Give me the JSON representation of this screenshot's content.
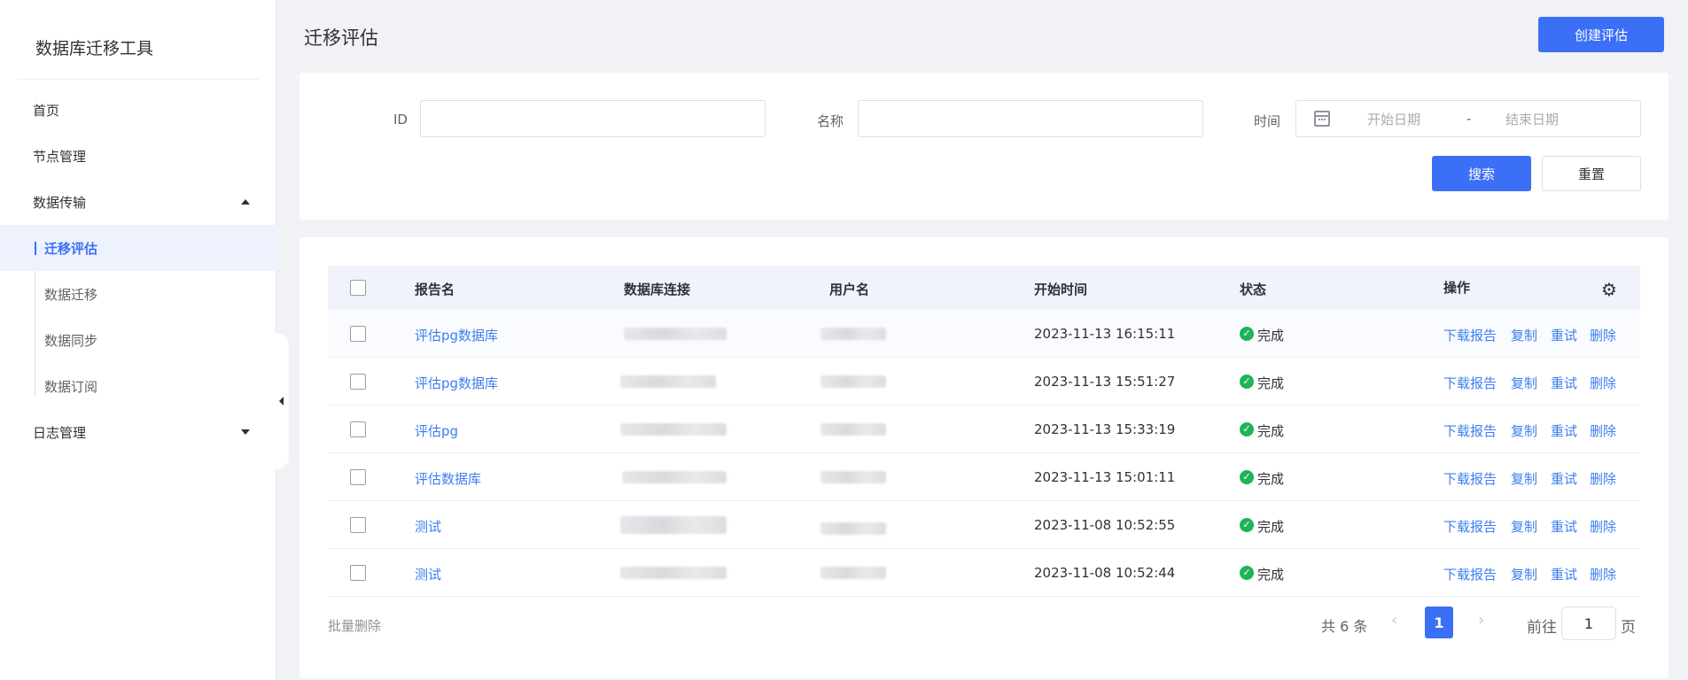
{
  "app": {
    "title": "数据库迁移工具"
  },
  "sidebar": {
    "items": [
      {
        "label": "首页"
      },
      {
        "label": "节点管理"
      },
      {
        "label": "数据传输"
      },
      {
        "label": "迁移评估"
      },
      {
        "label": "数据迁移"
      },
      {
        "label": "数据同步"
      },
      {
        "label": "数据订阅"
      },
      {
        "label": "日志管理"
      }
    ]
  },
  "header": {
    "title": "迁移评估",
    "create_label": "创建评估"
  },
  "filter": {
    "id_label": "ID",
    "name_label": "名称",
    "time_label": "时间",
    "id_value": "",
    "name_value": "",
    "date_start_placeholder": "开始日期",
    "date_separator": "-",
    "date_end_placeholder": "结束日期",
    "search_label": "搜索",
    "reset_label": "重置"
  },
  "table": {
    "columns": [
      "报告名",
      "数据库连接",
      "用户名",
      "开始时间",
      "状态",
      "操作"
    ],
    "rows": [
      {
        "name": "评估pg数据库",
        "time": "2023-11-13 16:15:11",
        "status": "完成"
      },
      {
        "name": "评估pg数据库",
        "time": "2023-11-13 15:51:27",
        "status": "完成"
      },
      {
        "name": "评估pg",
        "time": "2023-11-13 15:33:19",
        "status": "完成"
      },
      {
        "name": "评估数据库",
        "time": "2023-11-13 15:01:11",
        "status": "完成"
      },
      {
        "name": "测试",
        "time": "2023-11-08 10:52:55",
        "status": "完成"
      },
      {
        "name": "测试",
        "time": "2023-11-08 10:52:44",
        "status": "完成"
      }
    ],
    "actions": {
      "download": "下载报告",
      "copy": "复制",
      "retry": "重试",
      "delete": "删除"
    },
    "status_color": "#1fb35a",
    "link_color": "#3b7ff0"
  },
  "footer": {
    "batch_delete": "批量删除",
    "total": "共 6 条",
    "current_page": "1",
    "goto_prefix": "前往",
    "goto_value": "1",
    "goto_suffix": "页"
  },
  "theme": {
    "accent": "#3b6ff6",
    "background": "#f0f2f5"
  }
}
